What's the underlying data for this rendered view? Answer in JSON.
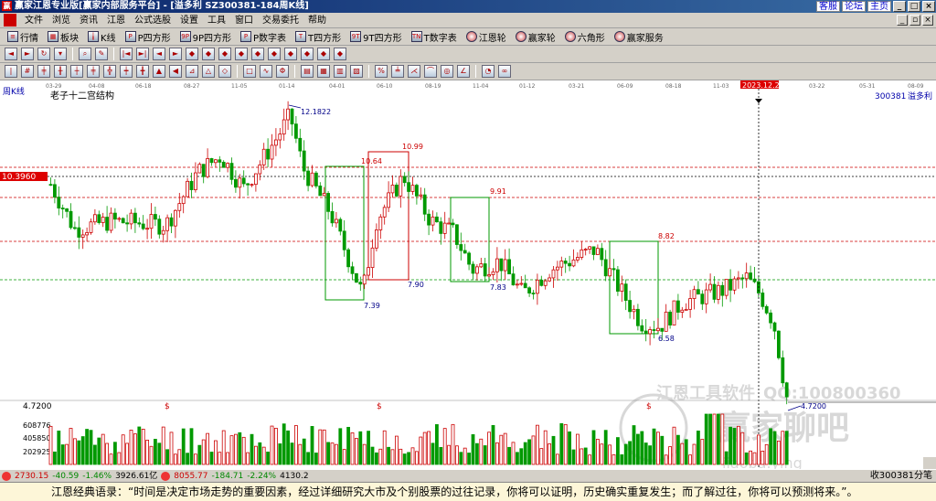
{
  "window": {
    "title": "赢家江恩专业版[赢家内部服务平台] - [溢多利  SZ300381-184周K线]",
    "top_links": [
      "客服",
      "论坛",
      "主页"
    ],
    "controls": [
      "_",
      "□",
      "×"
    ]
  },
  "menu": [
    "文件",
    "浏览",
    "资讯",
    "江恩",
    "公式选股",
    "设置",
    "工具",
    "窗口",
    "交易委托",
    "帮助"
  ],
  "toolbar1": [
    "行情",
    "板块",
    "K线",
    "P四方形",
    "9P四方形",
    "P数字表",
    "T四方形",
    "9T四方形",
    "T数字表",
    "江恩轮",
    "赢家轮",
    "六角形",
    "赢家服务"
  ],
  "chart": {
    "period_label": "周K线",
    "study_name": "老子十二宫结构",
    "stock_code": "300381",
    "stock_name": "溢多利",
    "price_tag": "10.3960",
    "cursor_date": "2023.12.22",
    "volume_price": "4.7200",
    "volume_ticks": [
      "608776",
      "405850",
      "202925"
    ],
    "watermark_company": "江恩工具软件",
    "watermark_qq": "QQ:100800360",
    "watermark_brand": "赢家聊吧",
    "watermark_sub": "iiaoba.ying",
    "date_ticks": [
      "03-29",
      "04-08",
      "06-18",
      "08-27",
      "11-05",
      "01-14",
      "04-01",
      "06-10",
      "08-19",
      "11-04",
      "01-12",
      "03-21",
      "06-09",
      "08-18",
      "11-03",
      "2023.12.22",
      "03-22",
      "05-31",
      "08-09"
    ],
    "annotations": [
      "12.1822",
      "10.64",
      "10.99",
      "9.91",
      "8.82",
      "7.39",
      "7.90",
      "7.83",
      "6.58",
      "4.7200"
    ],
    "volume_markers": [
      "$",
      "$",
      "$"
    ]
  },
  "status": {
    "idx1_value": "2730.15",
    "idx1_change": "-40.59",
    "idx1_pct": "-1.46%",
    "idx1_amount": "3926.61亿",
    "idx2_value": "8055.77",
    "idx2_change": "-184.71",
    "idx2_pct": "-2.24%",
    "idx2_amount": "4130.2",
    "right_text": "收300381分笔"
  },
  "quote": "江恩经典语录：“时间是决定市场走势的重要因素，经过详细研究大市及个别股票的过往记录，你将可以证明，历史确实重复发生；而了解过往，你将可以预测将来。”。",
  "colors": {
    "up": "#cc0000",
    "down": "#009900",
    "guide_red": "#cc0000",
    "guide_green": "#009900",
    "price_tag_bg": "#dd0000"
  }
}
